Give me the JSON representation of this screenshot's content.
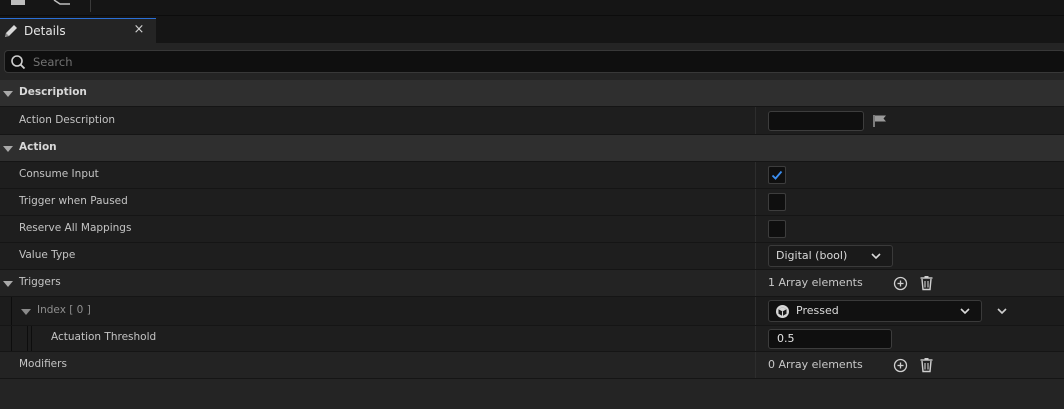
{
  "panel": {
    "tab_label": "Details",
    "tab_close": "×",
    "search_placeholder": "Search"
  },
  "categories": {
    "description": "Description",
    "action": "Action",
    "triggers": "Triggers",
    "modifiers": "Modifiers"
  },
  "properties": {
    "action_description": {
      "label": "Action Description",
      "value": ""
    },
    "consume_input": {
      "label": "Consume Input",
      "checked": true
    },
    "trigger_when_paused": {
      "label": "Trigger when Paused",
      "checked": false
    },
    "reserve_all_mappings": {
      "label": "Reserve All Mappings",
      "checked": false
    },
    "value_type": {
      "label": "Value Type",
      "selected": "Digital (bool)"
    },
    "triggers": {
      "count_text": "1 Array elements"
    },
    "index0": {
      "label": "Index [ 0 ]",
      "selected": "Pressed"
    },
    "actuation_threshold": {
      "label": "Actuation Threshold",
      "value": "0.5"
    },
    "modifiers": {
      "count_text": "0 Array elements"
    }
  },
  "colors": {
    "accent": "#2b6fd6",
    "checkmark": "#3b8ef0",
    "background": "#242424",
    "row_bg": "#1e1e1e",
    "category_bg": "#2f2f2f"
  },
  "icons": [
    "pencil-icon",
    "close-icon",
    "search-icon",
    "flag-icon",
    "checkmark-icon",
    "chevron-down-icon",
    "add-circle-icon",
    "trash-icon",
    "trigger-pressed-icon"
  ]
}
